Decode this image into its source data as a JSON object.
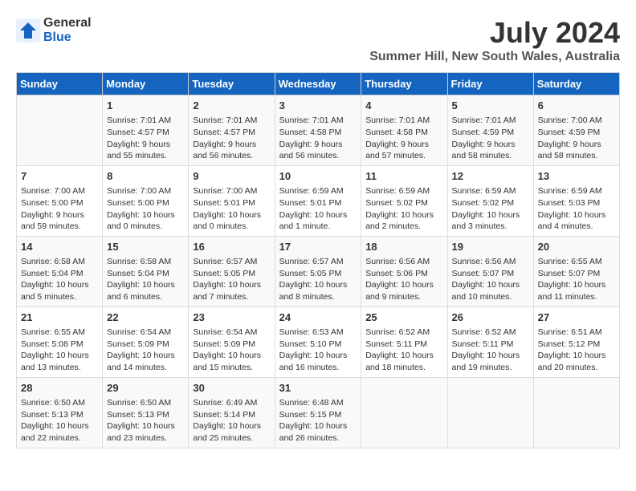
{
  "header": {
    "logo_line1": "General",
    "logo_line2": "Blue",
    "month_year": "July 2024",
    "location": "Summer Hill, New South Wales, Australia"
  },
  "weekdays": [
    "Sunday",
    "Monday",
    "Tuesday",
    "Wednesday",
    "Thursday",
    "Friday",
    "Saturday"
  ],
  "weeks": [
    [
      {
        "day": "",
        "sunrise": "",
        "sunset": "",
        "daylight": ""
      },
      {
        "day": "1",
        "sunrise": "Sunrise: 7:01 AM",
        "sunset": "Sunset: 4:57 PM",
        "daylight": "Daylight: 9 hours and 55 minutes."
      },
      {
        "day": "2",
        "sunrise": "Sunrise: 7:01 AM",
        "sunset": "Sunset: 4:57 PM",
        "daylight": "Daylight: 9 hours and 56 minutes."
      },
      {
        "day": "3",
        "sunrise": "Sunrise: 7:01 AM",
        "sunset": "Sunset: 4:58 PM",
        "daylight": "Daylight: 9 hours and 56 minutes."
      },
      {
        "day": "4",
        "sunrise": "Sunrise: 7:01 AM",
        "sunset": "Sunset: 4:58 PM",
        "daylight": "Daylight: 9 hours and 57 minutes."
      },
      {
        "day": "5",
        "sunrise": "Sunrise: 7:01 AM",
        "sunset": "Sunset: 4:59 PM",
        "daylight": "Daylight: 9 hours and 58 minutes."
      },
      {
        "day": "6",
        "sunrise": "Sunrise: 7:00 AM",
        "sunset": "Sunset: 4:59 PM",
        "daylight": "Daylight: 9 hours and 58 minutes."
      }
    ],
    [
      {
        "day": "7",
        "sunrise": "Sunrise: 7:00 AM",
        "sunset": "Sunset: 5:00 PM",
        "daylight": "Daylight: 9 hours and 59 minutes."
      },
      {
        "day": "8",
        "sunrise": "Sunrise: 7:00 AM",
        "sunset": "Sunset: 5:00 PM",
        "daylight": "Daylight: 10 hours and 0 minutes."
      },
      {
        "day": "9",
        "sunrise": "Sunrise: 7:00 AM",
        "sunset": "Sunset: 5:01 PM",
        "daylight": "Daylight: 10 hours and 0 minutes."
      },
      {
        "day": "10",
        "sunrise": "Sunrise: 6:59 AM",
        "sunset": "Sunset: 5:01 PM",
        "daylight": "Daylight: 10 hours and 1 minute."
      },
      {
        "day": "11",
        "sunrise": "Sunrise: 6:59 AM",
        "sunset": "Sunset: 5:02 PM",
        "daylight": "Daylight: 10 hours and 2 minutes."
      },
      {
        "day": "12",
        "sunrise": "Sunrise: 6:59 AM",
        "sunset": "Sunset: 5:02 PM",
        "daylight": "Daylight: 10 hours and 3 minutes."
      },
      {
        "day": "13",
        "sunrise": "Sunrise: 6:59 AM",
        "sunset": "Sunset: 5:03 PM",
        "daylight": "Daylight: 10 hours and 4 minutes."
      }
    ],
    [
      {
        "day": "14",
        "sunrise": "Sunrise: 6:58 AM",
        "sunset": "Sunset: 5:04 PM",
        "daylight": "Daylight: 10 hours and 5 minutes."
      },
      {
        "day": "15",
        "sunrise": "Sunrise: 6:58 AM",
        "sunset": "Sunset: 5:04 PM",
        "daylight": "Daylight: 10 hours and 6 minutes."
      },
      {
        "day": "16",
        "sunrise": "Sunrise: 6:57 AM",
        "sunset": "Sunset: 5:05 PM",
        "daylight": "Daylight: 10 hours and 7 minutes."
      },
      {
        "day": "17",
        "sunrise": "Sunrise: 6:57 AM",
        "sunset": "Sunset: 5:05 PM",
        "daylight": "Daylight: 10 hours and 8 minutes."
      },
      {
        "day": "18",
        "sunrise": "Sunrise: 6:56 AM",
        "sunset": "Sunset: 5:06 PM",
        "daylight": "Daylight: 10 hours and 9 minutes."
      },
      {
        "day": "19",
        "sunrise": "Sunrise: 6:56 AM",
        "sunset": "Sunset: 5:07 PM",
        "daylight": "Daylight: 10 hours and 10 minutes."
      },
      {
        "day": "20",
        "sunrise": "Sunrise: 6:55 AM",
        "sunset": "Sunset: 5:07 PM",
        "daylight": "Daylight: 10 hours and 11 minutes."
      }
    ],
    [
      {
        "day": "21",
        "sunrise": "Sunrise: 6:55 AM",
        "sunset": "Sunset: 5:08 PM",
        "daylight": "Daylight: 10 hours and 13 minutes."
      },
      {
        "day": "22",
        "sunrise": "Sunrise: 6:54 AM",
        "sunset": "Sunset: 5:09 PM",
        "daylight": "Daylight: 10 hours and 14 minutes."
      },
      {
        "day": "23",
        "sunrise": "Sunrise: 6:54 AM",
        "sunset": "Sunset: 5:09 PM",
        "daylight": "Daylight: 10 hours and 15 minutes."
      },
      {
        "day": "24",
        "sunrise": "Sunrise: 6:53 AM",
        "sunset": "Sunset: 5:10 PM",
        "daylight": "Daylight: 10 hours and 16 minutes."
      },
      {
        "day": "25",
        "sunrise": "Sunrise: 6:52 AM",
        "sunset": "Sunset: 5:11 PM",
        "daylight": "Daylight: 10 hours and 18 minutes."
      },
      {
        "day": "26",
        "sunrise": "Sunrise: 6:52 AM",
        "sunset": "Sunset: 5:11 PM",
        "daylight": "Daylight: 10 hours and 19 minutes."
      },
      {
        "day": "27",
        "sunrise": "Sunrise: 6:51 AM",
        "sunset": "Sunset: 5:12 PM",
        "daylight": "Daylight: 10 hours and 20 minutes."
      }
    ],
    [
      {
        "day": "28",
        "sunrise": "Sunrise: 6:50 AM",
        "sunset": "Sunset: 5:13 PM",
        "daylight": "Daylight: 10 hours and 22 minutes."
      },
      {
        "day": "29",
        "sunrise": "Sunrise: 6:50 AM",
        "sunset": "Sunset: 5:13 PM",
        "daylight": "Daylight: 10 hours and 23 minutes."
      },
      {
        "day": "30",
        "sunrise": "Sunrise: 6:49 AM",
        "sunset": "Sunset: 5:14 PM",
        "daylight": "Daylight: 10 hours and 25 minutes."
      },
      {
        "day": "31",
        "sunrise": "Sunrise: 6:48 AM",
        "sunset": "Sunset: 5:15 PM",
        "daylight": "Daylight: 10 hours and 26 minutes."
      },
      {
        "day": "",
        "sunrise": "",
        "sunset": "",
        "daylight": ""
      },
      {
        "day": "",
        "sunrise": "",
        "sunset": "",
        "daylight": ""
      },
      {
        "day": "",
        "sunrise": "",
        "sunset": "",
        "daylight": ""
      }
    ]
  ]
}
